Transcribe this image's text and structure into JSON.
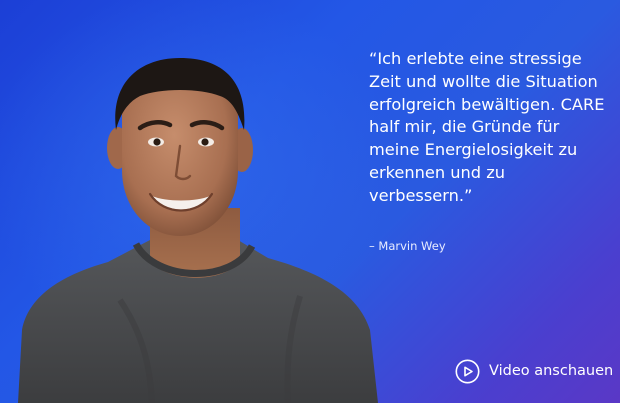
{
  "testimonial": {
    "quote": "“Ich erlebte eine stressige Zeit und wollte die Situation erfolgreich bewältigen. CARE half mir, die Gründe für meine Energielosigkeit zu erkennen und zu verbessern.”",
    "attribution": "– Marvin Wey"
  },
  "video_button": {
    "label": "Video anschauen",
    "icon": "play-circle-icon"
  },
  "colors": {
    "background_primary": "#2357e6",
    "background_secondary": "#5a38c6",
    "shirt": "#4a4b4c",
    "text": "#ffffff"
  }
}
